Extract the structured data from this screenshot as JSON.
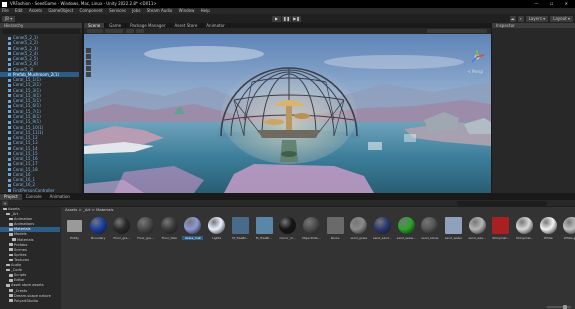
{
  "window": {
    "title": "VRFashion - SeedGame - Windows, Mac, Linux - Unity 2022.2.8* <DX11>",
    "controls": "—  ☐  ✕"
  },
  "menu": [
    "File",
    "Edit",
    "Assets",
    "GameObject",
    "Component",
    "Services",
    "Jobs",
    "Steam Audio",
    "Window",
    "Help"
  ],
  "toolbar": {
    "account": "JB ▾",
    "play_icons": [
      "▶",
      "❚❚",
      "▶❚"
    ],
    "layers": "Layers ▾",
    "layout": "Layout ▾",
    "search_icon": "search-icon",
    "cloud_icon": "cloud-icon"
  },
  "hierarchy": {
    "tab": "Hierarchy",
    "rows": [
      "Cone(5_2_1)",
      "Cone(5_2_2)",
      "Cone(5_2_3)",
      "Cone(5_2_4)",
      "Cone(5_2_5)",
      "Cone(5_2_6)",
      "Cone(5_3)",
      "Prefab_Mushroom_2(1)",
      "Coral_15_1(1)",
      "Coral_15_2(1)",
      "Coral_15_3(1)",
      "Coral_15_4(1)",
      "Coral_15_5(1)",
      "Coral_15_6(1)",
      "Coral_15_7(1)",
      "Coral_15_8(1)",
      "Coral_15_9(1)",
      "Coral_15_10(1)",
      "Coral_15_11(1)",
      "Coral_15_12",
      "Coral_15_13",
      "Coral_15_14",
      "Coral_15_15",
      "Coral_15_16",
      "Coral_15_17",
      "Coral_15_18",
      "Coral_16",
      "Coral_16_1",
      "Coral_16_2",
      "FirstPersonController",
      "Scene",
      "SM_WaterPlane_Main",
      "SM_WaterPlane_High"
    ],
    "selected_index": 7
  },
  "scene": {
    "tabs": [
      "Scene",
      "Game",
      "Package Manager",
      "Asset Store",
      "Animator"
    ],
    "active_tab": 0,
    "persp_label": "< Persp"
  },
  "inspector": {
    "tab": "Inspector"
  },
  "bottom": {
    "tabs": [
      "Project",
      "Console",
      "Animation"
    ],
    "active_tab": 0,
    "plus": "+ ▾"
  },
  "project_tree": [
    "Assets",
    "_Art",
    "Animation",
    "Animations",
    "Materials",
    "Models",
    "Materials",
    "Prefabs",
    "Scenes",
    "Sprites",
    "Textures",
    "Audio",
    "_Code",
    "Scripts",
    "Editor",
    "Asset store assets",
    "_Crests",
    "Dream-scape nature",
    "PolyartStudio"
  ],
  "project_tree_selected": 4,
  "breadcrumb": "Assets > _Art > Materials",
  "assets": [
    {
      "label": "Entity",
      "kind": "folder",
      "color": "#9a9a9a"
    },
    {
      "label": "Boundary",
      "kind": "sphere",
      "color": "#1a3fa8"
    },
    {
      "label": "Floor_gre...",
      "kind": "sphere",
      "color": "#2a2a2a"
    },
    {
      "label": "Floor_gre...",
      "kind": "sphere",
      "color": "#4a4a4a"
    },
    {
      "label": "Floor_tiles",
      "kind": "sphere",
      "color": "#3b3b3b"
    },
    {
      "label": "Glass_mat",
      "kind": "sphere",
      "color": "#8c9ad6"
    },
    {
      "label": "Lights",
      "kind": "sphere",
      "color": "#e8f1ff"
    },
    {
      "label": "M_TreeBr...",
      "kind": "square",
      "color": "#4a6a8a"
    },
    {
      "label": "M_TreeBr...",
      "kind": "square",
      "color": "#5a86a8"
    },
    {
      "label": "mirror_m...",
      "kind": "sphere",
      "color": "#141414"
    },
    {
      "label": "ObjectInte...",
      "kind": "sphere",
      "color": "#4d4d4d"
    },
    {
      "label": "Rocks",
      "kind": "square",
      "color": "#6a6a6a"
    },
    {
      "label": "sand_grass",
      "kind": "sphere",
      "color": "#8a8a8a"
    },
    {
      "label": "sand_sand...",
      "kind": "sphere",
      "color": "#2c3b72"
    },
    {
      "label": "sand_seaw...",
      "kind": "sphere",
      "color": "#2aa52a"
    },
    {
      "label": "sand_stone",
      "kind": "sphere",
      "color": "#555555"
    },
    {
      "label": "sand_water",
      "kind": "square",
      "color": "#8fa2bb"
    },
    {
      "label": "sand_wav...",
      "kind": "sphere",
      "color": "#b5b5b5"
    },
    {
      "label": "Shinymat...",
      "kind": "square",
      "color": "#a82020"
    },
    {
      "label": "Shinymat...",
      "kind": "sphere",
      "color": "#d9d9d9"
    },
    {
      "label": "White",
      "kind": "sphere",
      "color": "#f2f2f2"
    },
    {
      "label": "White.grey",
      "kind": "sphere",
      "color": "#c2c2c2"
    }
  ],
  "assets_selected": 5,
  "colors": {
    "selection": "#2c5d87",
    "panel": "#282828",
    "dark": "#191919"
  }
}
